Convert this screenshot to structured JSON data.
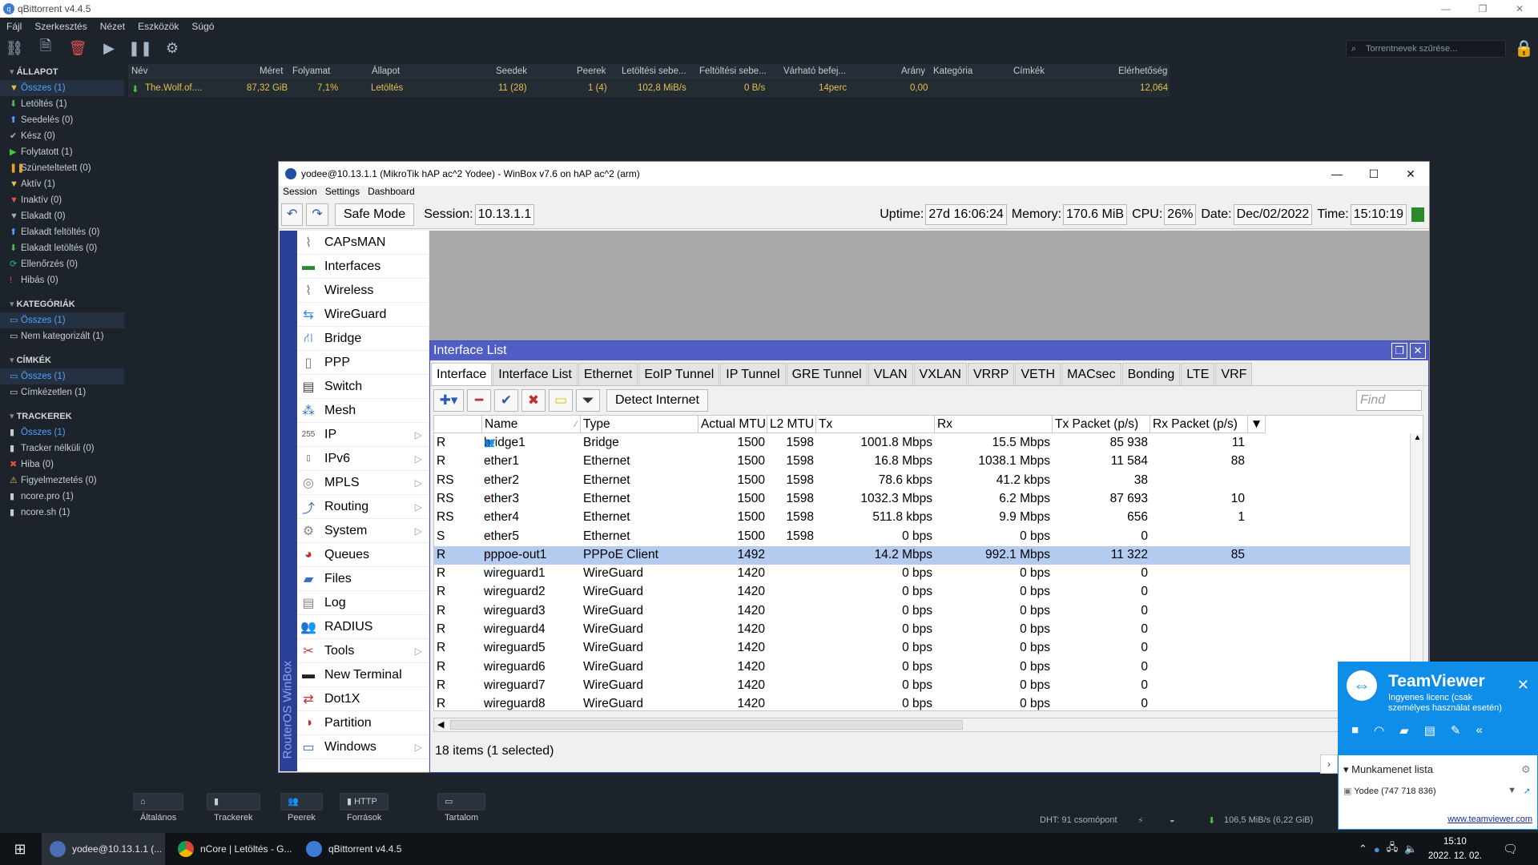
{
  "qb": {
    "title": "qBittorrent v4.4.5",
    "menu": [
      "Fájl",
      "Szerkesztés",
      "Nézet",
      "Eszközök",
      "Súgó"
    ],
    "search_placeholder": "Torrentnevek szűrése...",
    "sections": {
      "status": {
        "header": "ÁLLAPOT",
        "items": [
          "Összes (1)",
          "Letöltés (1)",
          "Seedelés (0)",
          "Kész (0)",
          "Folytatott (1)",
          "Szüneteltetett (0)",
          "Aktív (1)",
          "Inaktív (0)",
          "Elakadt (0)",
          "Elakadt feltöltés (0)",
          "Elakadt letöltés (0)",
          "Ellenőrzés (0)",
          "Hibás (0)"
        ]
      },
      "categories": {
        "header": "KATEGÓRIÁK",
        "items": [
          "Összes (1)",
          "Nem kategorizált (1)"
        ]
      },
      "tags": {
        "header": "CÍMKÉK",
        "items": [
          "Összes (1)",
          "Címkézetlen (1)"
        ]
      },
      "trackers": {
        "header": "TRACKEREK",
        "items": [
          "Összes (1)",
          "Tracker nélküli (0)",
          "Hiba (0)",
          "Figyelmeztetés (0)",
          "ncore.pro (1)",
          "ncore.sh (1)"
        ]
      }
    },
    "columns": [
      "Név",
      "Méret",
      "Folyamat",
      "Állapot",
      "Seedek",
      "Peerek",
      "Letöltési sebe...",
      "Feltöltési sebe...",
      "Várható befej...",
      "Arány",
      "Kategória",
      "Címkék",
      "Elérhetőség"
    ],
    "torrent": {
      "name": "The.Wolf.of....",
      "size": "87,32 GiB",
      "progress": "7,1%",
      "status": "Letöltés",
      "seeds": "11 (28)",
      "peers": "1 (4)",
      "dl": "102,8 MiB/s",
      "ul": "0 B/s",
      "eta": "14perc",
      "ratio": "0,00",
      "category": "",
      "tags": "",
      "availability": "12,064"
    },
    "bottom_tabs": [
      "Általános",
      "Trackerek",
      "Peerek",
      "HTTP Források",
      "Tartalom"
    ],
    "status_bar": {
      "dht": "DHT: 91 csomópont",
      "speed": "106,5 MiB/s (6,22 GiB)"
    }
  },
  "winbox": {
    "title": "yodee@10.13.1.1 (MikroTik hAP ac^2 Yodee) - WinBox v7.6 on hAP ac^2 (arm)",
    "menu": [
      "Session",
      "Settings",
      "Dashboard"
    ],
    "safe_mode": "Safe Mode",
    "session_label": "Session:",
    "session": "10.13.1.1",
    "uptime_label": "Uptime:",
    "uptime": "27d 16:06:24",
    "memory_label": "Memory:",
    "memory": "170.6 MiB",
    "cpu_label": "CPU:",
    "cpu": "26%",
    "date_label": "Date:",
    "date": "Dec/02/2022",
    "time_label": "Time:",
    "time": "15:10:19",
    "vertical": "RouterOS WinBox",
    "nav": [
      "CAPsMAN",
      "Interfaces",
      "Wireless",
      "WireGuard",
      "Bridge",
      "PPP",
      "Switch",
      "Mesh",
      "IP",
      "IPv6",
      "MPLS",
      "Routing",
      "System",
      "Queues",
      "Files",
      "Log",
      "RADIUS",
      "Tools",
      "New Terminal",
      "Dot1X",
      "Partition",
      "Windows"
    ],
    "interface_list": {
      "title": "Interface List",
      "tabs": [
        "Interface",
        "Interface List",
        "Ethernet",
        "EoIP Tunnel",
        "IP Tunnel",
        "GRE Tunnel",
        "VLAN",
        "VXLAN",
        "VRRP",
        "VETH",
        "MACsec",
        "Bonding",
        "LTE",
        "VRF"
      ],
      "detect": "Detect Internet",
      "find_placeholder": "Find",
      "columns": [
        "",
        "Name",
        "Type",
        "Actual MTU",
        "L2 MTU",
        "Tx",
        "Rx",
        "Tx Packet (p/s)",
        "Rx Packet (p/s)"
      ],
      "rows": [
        [
          "R",
          "bridge1",
          "Bridge",
          "1500",
          "1598",
          "1001.8 Mbps",
          "15.5 Mbps",
          "85 938",
          "11"
        ],
        [
          "R",
          "ether1",
          "Ethernet",
          "1500",
          "1598",
          "16.8 Mbps",
          "1038.1 Mbps",
          "11 584",
          "88"
        ],
        [
          "RS",
          "ether2",
          "Ethernet",
          "1500",
          "1598",
          "78.6 kbps",
          "41.2 kbps",
          "38",
          ""
        ],
        [
          "RS",
          "ether3",
          "Ethernet",
          "1500",
          "1598",
          "1032.3 Mbps",
          "6.2 Mbps",
          "87 693",
          "10"
        ],
        [
          "RS",
          "ether4",
          "Ethernet",
          "1500",
          "1598",
          "511.8 kbps",
          "9.9 Mbps",
          "656",
          "1"
        ],
        [
          "S",
          "ether5",
          "Ethernet",
          "1500",
          "1598",
          "0 bps",
          "0 bps",
          "0",
          ""
        ],
        [
          "R",
          "pppoe-out1",
          "PPPoE Client",
          "1492",
          "",
          "14.2 Mbps",
          "992.1 Mbps",
          "11 322",
          "85"
        ],
        [
          "R",
          "wireguard1",
          "WireGuard",
          "1420",
          "",
          "0 bps",
          "0 bps",
          "0",
          ""
        ],
        [
          "R",
          "wireguard2",
          "WireGuard",
          "1420",
          "",
          "0 bps",
          "0 bps",
          "0",
          ""
        ],
        [
          "R",
          "wireguard3",
          "WireGuard",
          "1420",
          "",
          "0 bps",
          "0 bps",
          "0",
          ""
        ],
        [
          "R",
          "wireguard4",
          "WireGuard",
          "1420",
          "",
          "0 bps",
          "0 bps",
          "0",
          ""
        ],
        [
          "R",
          "wireguard5",
          "WireGuard",
          "1420",
          "",
          "0 bps",
          "0 bps",
          "0",
          ""
        ],
        [
          "R",
          "wireguard6",
          "WireGuard",
          "1420",
          "",
          "0 bps",
          "0 bps",
          "0",
          ""
        ],
        [
          "R",
          "wireguard7",
          "WireGuard",
          "1420",
          "",
          "0 bps",
          "0 bps",
          "0",
          ""
        ],
        [
          "R",
          "wireguard8",
          "WireGuard",
          "1420",
          "",
          "0 bps",
          "0 bps",
          "0",
          ""
        ]
      ],
      "selected_row": 6,
      "status": "18 items (1 selected)"
    }
  },
  "teamviewer": {
    "name": "TeamViewer",
    "subtitle": "Ingyenes licenc (csak személyes használat esetén)",
    "session_list": "Munkamenet lista",
    "user": "Yodee (747 718 836)",
    "link": "www.teamviewer.com"
  },
  "taskbar": {
    "items": [
      "yodee@10.13.1.1 (...",
      "nCore | Letöltés - G...",
      "qBittorrent v4.4.5"
    ],
    "time": "15:10",
    "date": "2022. 12. 02."
  }
}
